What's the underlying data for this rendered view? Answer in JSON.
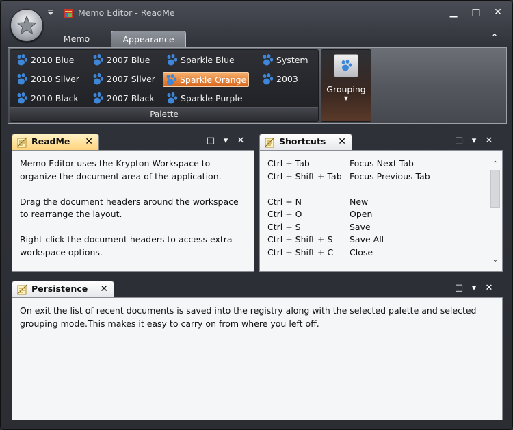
{
  "window": {
    "title": "Memo Editor - ReadMe",
    "controls": {
      "minimize": "▁",
      "maximize": "□",
      "close": "✕"
    }
  },
  "ribbon": {
    "tabs": [
      {
        "label": "Memo",
        "active": false
      },
      {
        "label": "Appearance",
        "active": true
      }
    ],
    "collapse_glyph": "⌃",
    "palette_group": {
      "label": "Palette",
      "items": [
        {
          "label": "2010 Blue",
          "selected": false
        },
        {
          "label": "2007 Blue",
          "selected": false
        },
        {
          "label": "Sparkle  Blue",
          "selected": false
        },
        {
          "label": "System",
          "selected": false
        },
        {
          "label": "2010 Silver",
          "selected": false
        },
        {
          "label": "2007 Silver",
          "selected": false
        },
        {
          "label": "Sparkle  Orange",
          "selected": true
        },
        {
          "label": "2003",
          "selected": false
        },
        {
          "label": "2010 Black",
          "selected": false
        },
        {
          "label": "2007 Black",
          "selected": false
        },
        {
          "label": "Sparkle  Purple",
          "selected": false
        }
      ]
    },
    "grouping_group": {
      "label": "Grouping",
      "arrow": "▼"
    }
  },
  "panels": {
    "readme": {
      "tab_label": "ReadMe",
      "close_glyph": "✕",
      "paragraphs": [
        "Memo Editor uses the Krypton Workspace to organize the document area of the application.",
        "Drag the document headers around the workspace to rearrange the layout.",
        "Right-click the document headers to access extra workspace options."
      ]
    },
    "shortcuts": {
      "tab_label": "Shortcuts",
      "close_glyph": "✕",
      "rows": [
        {
          "key": "Ctrl + Tab",
          "action": "Focus Next Tab"
        },
        {
          "key": "Ctrl + Shift + Tab",
          "action": "Focus Previous Tab"
        },
        {
          "key": "",
          "action": ""
        },
        {
          "key": "Ctrl + N",
          "action": "New"
        },
        {
          "key": "Ctrl + O",
          "action": "Open"
        },
        {
          "key": "Ctrl + S",
          "action": "Save"
        },
        {
          "key": "Ctrl + Shift + S",
          "action": "Save All"
        },
        {
          "key": "Ctrl + Shift + C",
          "action": "Close"
        }
      ],
      "scroll_up": "⌃",
      "scroll_down": "⌄"
    },
    "persistence": {
      "tab_label": "Persistence",
      "close_glyph": "✕",
      "text": "On exit the list of recent documents is saved into the registry along with the selected palette and selected grouping mode.This makes it easy to carry on from where you left off."
    },
    "strip_buttons": {
      "maximize": "□",
      "dropdown": "▾",
      "close": "✕"
    }
  },
  "colors": {
    "active_tab": "#ffd27a",
    "selected_palette": "#e0782c",
    "window_bg": "#2b2d33"
  },
  "icons": {
    "app": "star-orb-icon",
    "title": "document-icon",
    "palette": "paw-icon",
    "tab": "memo-pad-icon"
  }
}
